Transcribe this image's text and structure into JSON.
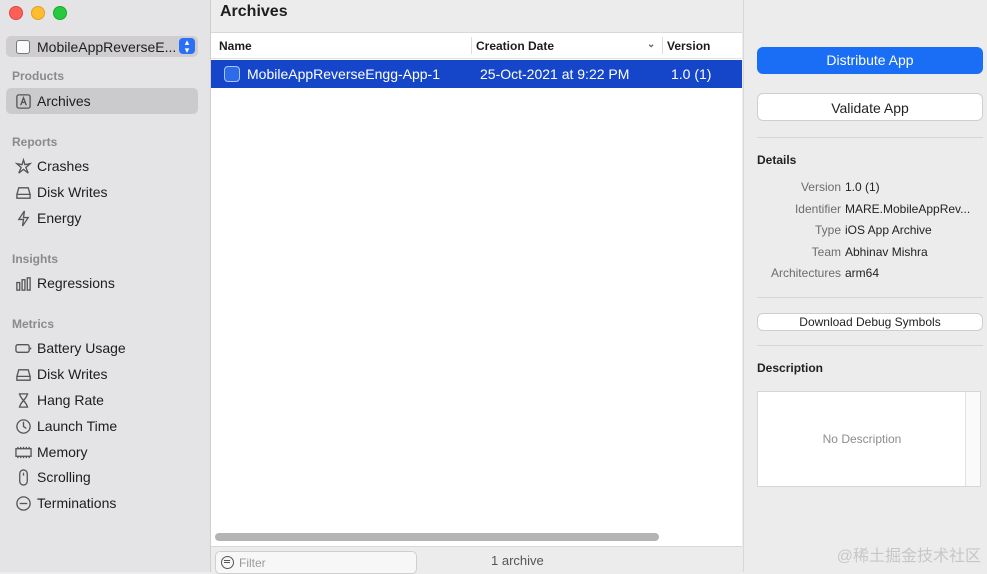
{
  "sidebar": {
    "scheme_label": "MobileAppReverseE...",
    "sections": {
      "products": "Products",
      "reports": "Reports",
      "insights": "Insights",
      "metrics": "Metrics"
    },
    "products_items": [
      {
        "label": "Archives",
        "icon": "archive-icon",
        "selected": true
      }
    ],
    "reports_items": [
      {
        "label": "Crashes",
        "icon": "crash-icon"
      },
      {
        "label": "Disk Writes",
        "icon": "disk-icon"
      },
      {
        "label": "Energy",
        "icon": "bolt-icon"
      }
    ],
    "insights_items": [
      {
        "label": "Regressions",
        "icon": "chart-bars-icon"
      }
    ],
    "metrics_items": [
      {
        "label": "Battery Usage",
        "icon": "battery-icon"
      },
      {
        "label": "Disk Writes",
        "icon": "disk-icon"
      },
      {
        "label": "Hang Rate",
        "icon": "hourglass-icon"
      },
      {
        "label": "Launch Time",
        "icon": "clock-icon"
      },
      {
        "label": "Memory",
        "icon": "memory-chip-icon"
      },
      {
        "label": "Scrolling",
        "icon": "scroll-icon"
      },
      {
        "label": "Terminations",
        "icon": "minus-circle-icon"
      }
    ]
  },
  "main": {
    "title": "Archives",
    "columns": {
      "name": "Name",
      "creation_date": "Creation Date",
      "version": "Version"
    },
    "rows": [
      {
        "name": "MobileAppReverseEngg-App-1",
        "creation_date": "25-Oct-2021 at 9:22 PM",
        "version": "1.0 (1)"
      }
    ],
    "filter_placeholder": "Filter",
    "archive_count": "1 archive"
  },
  "details_panel": {
    "distribute_label": "Distribute App",
    "validate_label": "Validate App",
    "details_title": "Details",
    "details": [
      {
        "key": "Version",
        "value": "1.0 (1)"
      },
      {
        "key": "Identifier",
        "value": "MARE.MobileAppRev..."
      },
      {
        "key": "Type",
        "value": "iOS App Archive"
      },
      {
        "key": "Team",
        "value": "Abhinav Mishra"
      },
      {
        "key": "Architectures",
        "value": "arm64"
      }
    ],
    "download_debug_label": "Download Debug Symbols",
    "description_title": "Description",
    "description_placeholder": "No Description"
  },
  "watermark": "@稀土掘金技术社区",
  "colors": {
    "accent": "#1a6ef5",
    "selection": "#1546c9",
    "sidebar_bg": "#e4e3e5"
  }
}
